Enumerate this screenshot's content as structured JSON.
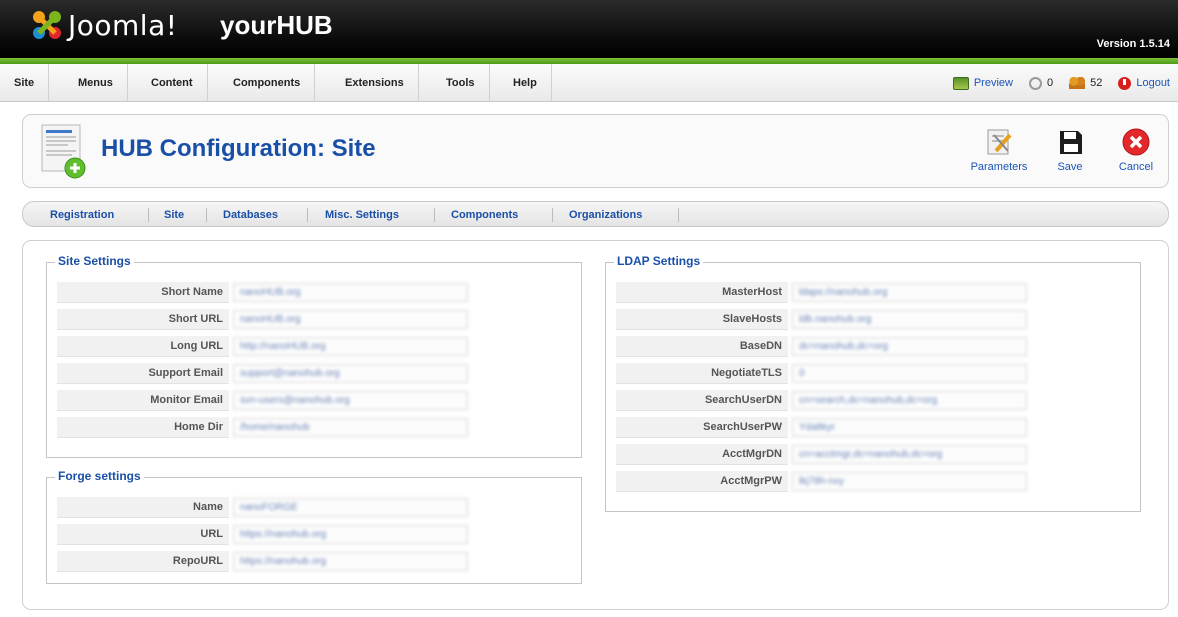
{
  "header": {
    "brand": "Joomla!",
    "site_name": "yourHUB",
    "version": "Version 1.5.14"
  },
  "menu": {
    "items": [
      "Site",
      "Menus",
      "Content",
      "Components",
      "Extensions",
      "Tools",
      "Help"
    ],
    "status": {
      "preview_label": "Preview",
      "messages_count": "0",
      "users_count": "52",
      "logout_label": "Logout"
    }
  },
  "toolbar": {
    "title": "HUB Configuration: Site",
    "parameters_label": "Parameters",
    "save_label": "Save",
    "cancel_label": "Cancel"
  },
  "submenu": {
    "items": [
      "Registration",
      "Site",
      "Databases",
      "Misc. Settings",
      "Components",
      "Organizations"
    ]
  },
  "site_settings": {
    "legend": "Site Settings",
    "fields": [
      {
        "label": "Short Name",
        "value": "nanoHUB.org"
      },
      {
        "label": "Short URL",
        "value": "nanoHUB.org"
      },
      {
        "label": "Long URL",
        "value": "http://nanoHUB.org"
      },
      {
        "label": "Support Email",
        "value": "support@nanohub.org"
      },
      {
        "label": "Monitor Email",
        "value": "svn-users@nanohub.org"
      },
      {
        "label": "Home Dir",
        "value": "/home/nanohub"
      }
    ]
  },
  "forge_settings": {
    "legend": "Forge settings",
    "fields": [
      {
        "label": "Name",
        "value": "nanoFORGE"
      },
      {
        "label": "URL",
        "value": "https://nanohub.org"
      },
      {
        "label": "RepoURL",
        "value": "https://nanohub.org"
      }
    ]
  },
  "ldap_settings": {
    "legend": "LDAP Settings",
    "fields": [
      {
        "label": "MasterHost",
        "value": "ldaps://nanohub.org"
      },
      {
        "label": "SlaveHosts",
        "value": "ldb.nanohub.org"
      },
      {
        "label": "BaseDN",
        "value": "dc=nanohub,dc=org"
      },
      {
        "label": "NegotiateTLS",
        "value": "0"
      },
      {
        "label": "SearchUserDN",
        "value": "cn=search,dc=nanohub,dc=org"
      },
      {
        "label": "SearchUserPW",
        "value": "Ydaltkyr"
      },
      {
        "label": "AcctMgrDN",
        "value": "cn=acctmgr,dc=nanohub,dc=org"
      },
      {
        "label": "AcctMgrPW",
        "value": "lkj78h-nxy"
      }
    ]
  },
  "colors": {
    "accent_blue": "#1a4fa8",
    "header_green": "#5aa41f",
    "header_black": "#0a0a0a"
  }
}
